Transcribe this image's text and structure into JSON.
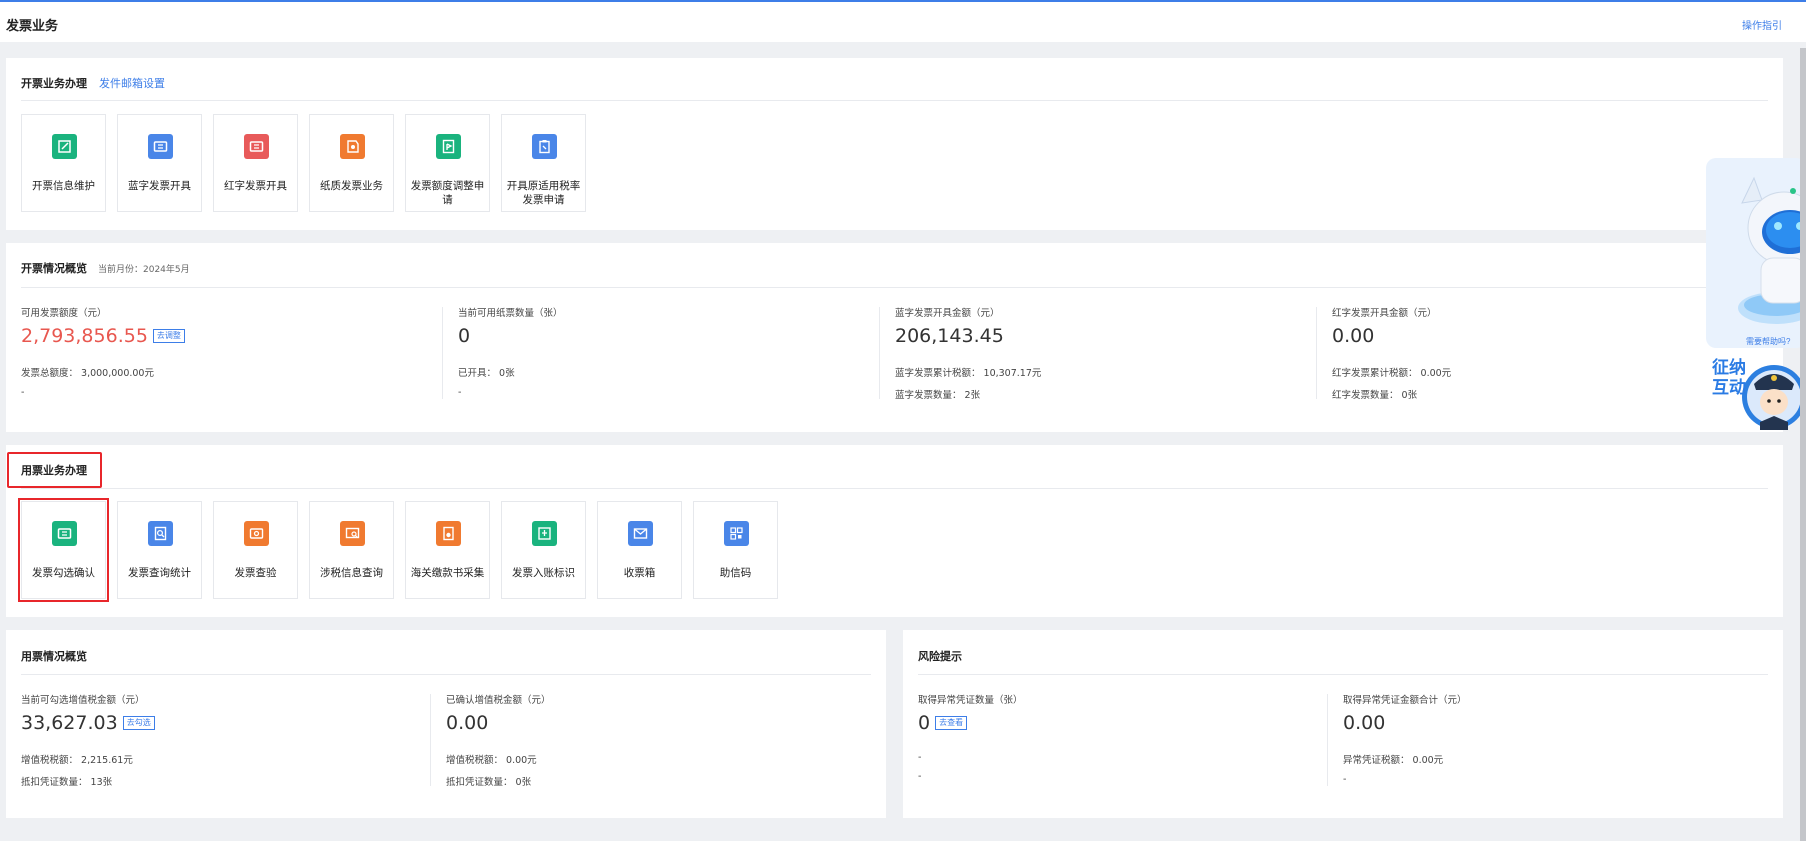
{
  "header": {
    "title": "发票业务",
    "guide_link": "操作指引"
  },
  "invoice_ops": {
    "title": "开票业务办理",
    "mail_link": "发件邮箱设置",
    "items": [
      {
        "label": "开票信息维护",
        "icon": "edit-icon",
        "color": "#1ab37e"
      },
      {
        "label": "蓝字发票开具",
        "icon": "ticket-icon",
        "color": "#4a86e8"
      },
      {
        "label": "红字发票开具",
        "icon": "ticket-icon",
        "color": "#e85a5a"
      },
      {
        "label": "纸质发票业务",
        "icon": "paper-icon",
        "color": "#f07a30"
      },
      {
        "label": "发票额度调整申请",
        "icon": "adjust-icon",
        "color": "#1ab37e"
      },
      {
        "label": "开具原适用税率发票申请",
        "icon": "clipboard-icon",
        "color": "#4a86e8"
      }
    ]
  },
  "issuance_overview": {
    "title": "开票情况概览",
    "period": "当前月份：2024年5月",
    "stats": [
      {
        "label": "可用发票额度（元）",
        "value": "2,793,856.55",
        "badge": "去调整",
        "line1": "发票总额度： 3,000,000.00元",
        "line2": "-"
      },
      {
        "label": "当前可用纸票数量（张）",
        "value": "0",
        "line1": "已开具： 0张",
        "line2": "-"
      },
      {
        "label": "蓝字发票开具金额（元）",
        "value": "206,143.45",
        "line1": "蓝字发票累计税额： 10,307.17元",
        "line2": "蓝字发票数量： 2张"
      },
      {
        "label": "红字发票开具金额（元）",
        "value": "0.00",
        "line1": "红字发票累计税额： 0.00元",
        "line2": "红字发票数量： 0张"
      }
    ]
  },
  "usage_ops": {
    "title": "用票业务办理",
    "items": [
      {
        "label": "发票勾选确认",
        "icon": "ticket-icon",
        "color": "#1ab37e"
      },
      {
        "label": "发票查询统计",
        "icon": "search-doc-icon",
        "color": "#4a86e8"
      },
      {
        "label": "发票查验",
        "icon": "verify-icon",
        "color": "#f07a30"
      },
      {
        "label": "涉税信息查询",
        "icon": "search-screen-icon",
        "color": "#f07a30"
      },
      {
        "label": "海关缴款书采集",
        "icon": "customs-icon",
        "color": "#f07a30"
      },
      {
        "label": "发票入账标识",
        "icon": "book-icon",
        "color": "#1ab37e"
      },
      {
        "label": "收票箱",
        "icon": "mail-icon",
        "color": "#4a86e8"
      },
      {
        "label": "助信码",
        "icon": "qrcode-icon",
        "color": "#4a86e8"
      }
    ]
  },
  "usage_overview": {
    "title": "用票情况概览",
    "stats": [
      {
        "label": "当前可勾选增值税金额（元）",
        "value": "33,627.03",
        "badge": "去勾选",
        "line1": "增值税税额： 2,215.61元",
        "line2": "抵扣凭证数量： 13张"
      },
      {
        "label": "已确认增值税金额（元）",
        "value": "0.00",
        "line1": "增值税税额： 0.00元",
        "line2": "抵扣凭证数量： 0张"
      }
    ]
  },
  "risk": {
    "title": "风险提示",
    "stats": [
      {
        "label": "取得异常凭证数量（张）",
        "value": "0",
        "badge": "去查看",
        "line1": "-",
        "line2": "-"
      },
      {
        "label": "取得异常凭证金额合计（元）",
        "value": "0.00",
        "line1": "异常凭证税额： 0.00元",
        "line2": "-"
      }
    ]
  },
  "assistant": {
    "robot_caption": "需要帮助吗?",
    "avatar_text": "征纳互动"
  }
}
